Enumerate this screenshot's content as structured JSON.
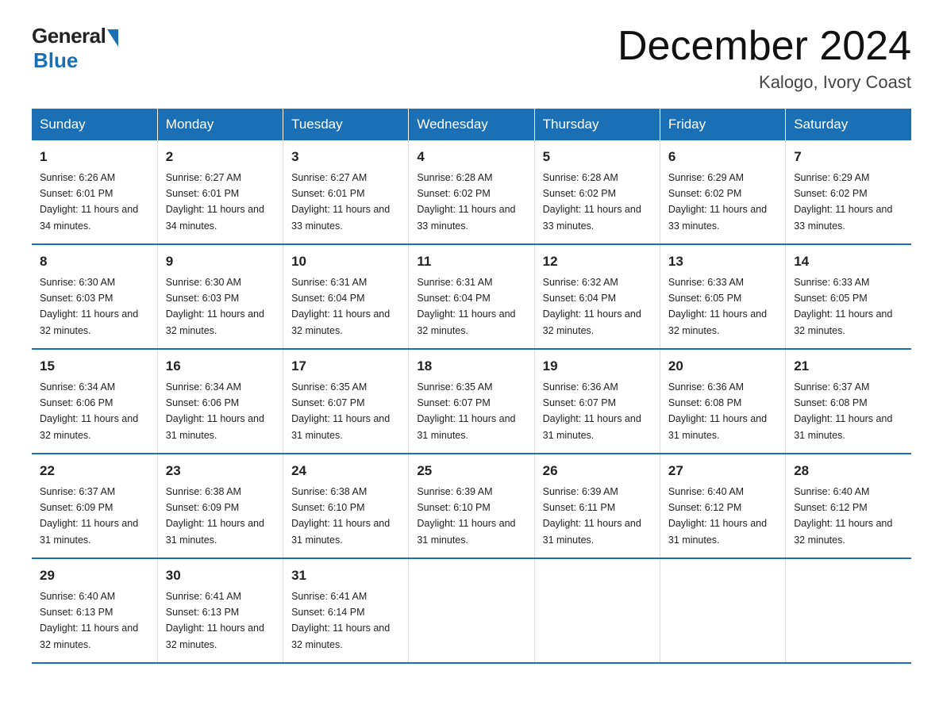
{
  "logo": {
    "general": "General",
    "blue": "Blue"
  },
  "title": "December 2024",
  "location": "Kalogo, Ivory Coast",
  "days_of_week": [
    "Sunday",
    "Monday",
    "Tuesday",
    "Wednesday",
    "Thursday",
    "Friday",
    "Saturday"
  ],
  "weeks": [
    [
      {
        "day": "1",
        "sunrise": "6:26 AM",
        "sunset": "6:01 PM",
        "daylight": "11 hours and 34 minutes."
      },
      {
        "day": "2",
        "sunrise": "6:27 AM",
        "sunset": "6:01 PM",
        "daylight": "11 hours and 34 minutes."
      },
      {
        "day": "3",
        "sunrise": "6:27 AM",
        "sunset": "6:01 PM",
        "daylight": "11 hours and 33 minutes."
      },
      {
        "day": "4",
        "sunrise": "6:28 AM",
        "sunset": "6:02 PM",
        "daylight": "11 hours and 33 minutes."
      },
      {
        "day": "5",
        "sunrise": "6:28 AM",
        "sunset": "6:02 PM",
        "daylight": "11 hours and 33 minutes."
      },
      {
        "day": "6",
        "sunrise": "6:29 AM",
        "sunset": "6:02 PM",
        "daylight": "11 hours and 33 minutes."
      },
      {
        "day": "7",
        "sunrise": "6:29 AM",
        "sunset": "6:02 PM",
        "daylight": "11 hours and 33 minutes."
      }
    ],
    [
      {
        "day": "8",
        "sunrise": "6:30 AM",
        "sunset": "6:03 PM",
        "daylight": "11 hours and 32 minutes."
      },
      {
        "day": "9",
        "sunrise": "6:30 AM",
        "sunset": "6:03 PM",
        "daylight": "11 hours and 32 minutes."
      },
      {
        "day": "10",
        "sunrise": "6:31 AM",
        "sunset": "6:04 PM",
        "daylight": "11 hours and 32 minutes."
      },
      {
        "day": "11",
        "sunrise": "6:31 AM",
        "sunset": "6:04 PM",
        "daylight": "11 hours and 32 minutes."
      },
      {
        "day": "12",
        "sunrise": "6:32 AM",
        "sunset": "6:04 PM",
        "daylight": "11 hours and 32 minutes."
      },
      {
        "day": "13",
        "sunrise": "6:33 AM",
        "sunset": "6:05 PM",
        "daylight": "11 hours and 32 minutes."
      },
      {
        "day": "14",
        "sunrise": "6:33 AM",
        "sunset": "6:05 PM",
        "daylight": "11 hours and 32 minutes."
      }
    ],
    [
      {
        "day": "15",
        "sunrise": "6:34 AM",
        "sunset": "6:06 PM",
        "daylight": "11 hours and 32 minutes."
      },
      {
        "day": "16",
        "sunrise": "6:34 AM",
        "sunset": "6:06 PM",
        "daylight": "11 hours and 31 minutes."
      },
      {
        "day": "17",
        "sunrise": "6:35 AM",
        "sunset": "6:07 PM",
        "daylight": "11 hours and 31 minutes."
      },
      {
        "day": "18",
        "sunrise": "6:35 AM",
        "sunset": "6:07 PM",
        "daylight": "11 hours and 31 minutes."
      },
      {
        "day": "19",
        "sunrise": "6:36 AM",
        "sunset": "6:07 PM",
        "daylight": "11 hours and 31 minutes."
      },
      {
        "day": "20",
        "sunrise": "6:36 AM",
        "sunset": "6:08 PM",
        "daylight": "11 hours and 31 minutes."
      },
      {
        "day": "21",
        "sunrise": "6:37 AM",
        "sunset": "6:08 PM",
        "daylight": "11 hours and 31 minutes."
      }
    ],
    [
      {
        "day": "22",
        "sunrise": "6:37 AM",
        "sunset": "6:09 PM",
        "daylight": "11 hours and 31 minutes."
      },
      {
        "day": "23",
        "sunrise": "6:38 AM",
        "sunset": "6:09 PM",
        "daylight": "11 hours and 31 minutes."
      },
      {
        "day": "24",
        "sunrise": "6:38 AM",
        "sunset": "6:10 PM",
        "daylight": "11 hours and 31 minutes."
      },
      {
        "day": "25",
        "sunrise": "6:39 AM",
        "sunset": "6:10 PM",
        "daylight": "11 hours and 31 minutes."
      },
      {
        "day": "26",
        "sunrise": "6:39 AM",
        "sunset": "6:11 PM",
        "daylight": "11 hours and 31 minutes."
      },
      {
        "day": "27",
        "sunrise": "6:40 AM",
        "sunset": "6:12 PM",
        "daylight": "11 hours and 31 minutes."
      },
      {
        "day": "28",
        "sunrise": "6:40 AM",
        "sunset": "6:12 PM",
        "daylight": "11 hours and 32 minutes."
      }
    ],
    [
      {
        "day": "29",
        "sunrise": "6:40 AM",
        "sunset": "6:13 PM",
        "daylight": "11 hours and 32 minutes."
      },
      {
        "day": "30",
        "sunrise": "6:41 AM",
        "sunset": "6:13 PM",
        "daylight": "11 hours and 32 minutes."
      },
      {
        "day": "31",
        "sunrise": "6:41 AM",
        "sunset": "6:14 PM",
        "daylight": "11 hours and 32 minutes."
      },
      null,
      null,
      null,
      null
    ]
  ]
}
